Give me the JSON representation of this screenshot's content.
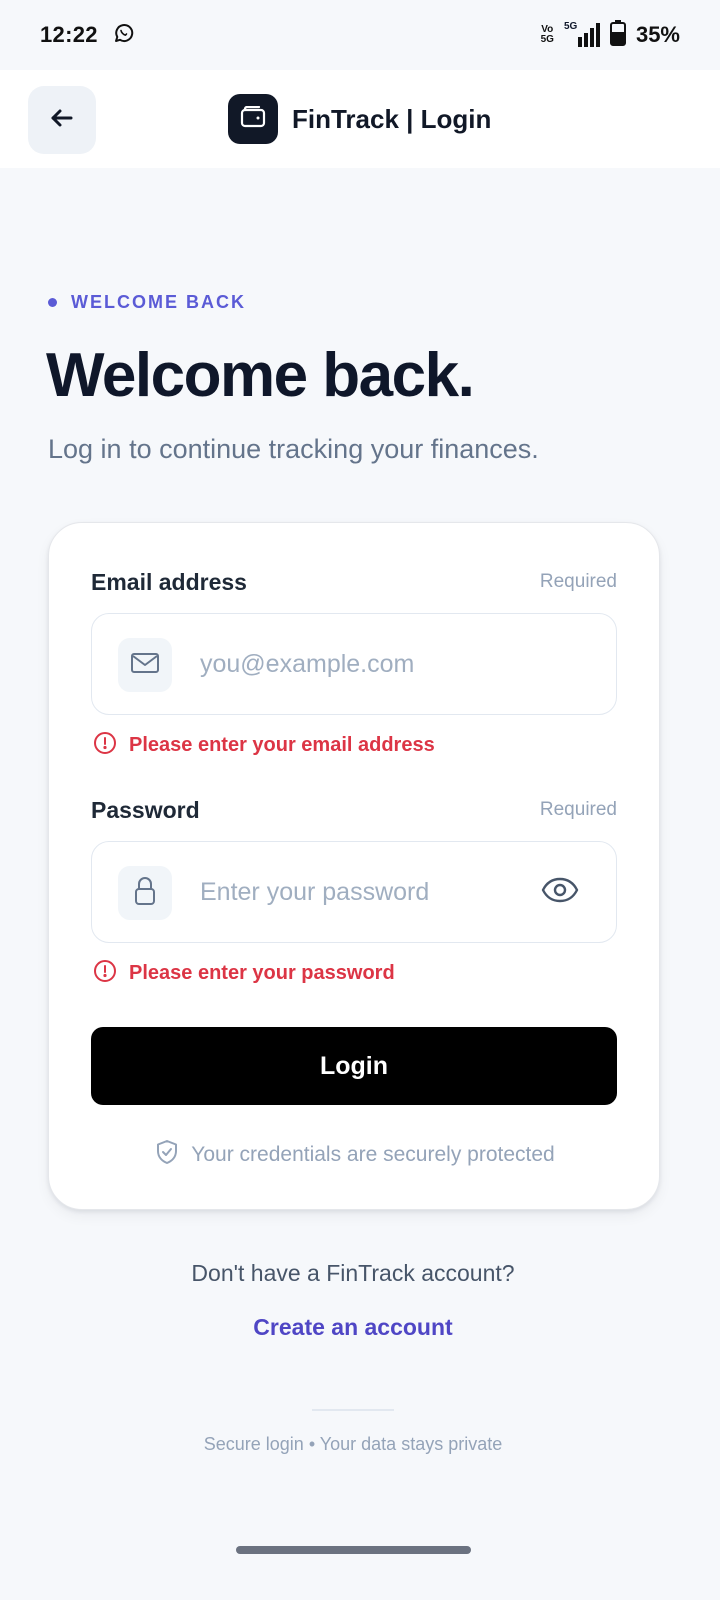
{
  "status_bar": {
    "time": "12:22",
    "network_top": "Vo",
    "network_bottom": "5G",
    "signal_label": "5G",
    "battery_percent": "35%"
  },
  "header": {
    "title": "FinTrack | Login",
    "back_icon": "arrow-left-icon",
    "logo_icon": "wallet-icon"
  },
  "intro": {
    "eyebrow": "WELCOME BACK",
    "title": "Welcome back.",
    "subtitle": "Log in to continue tracking your finances."
  },
  "form": {
    "email": {
      "label": "Email address",
      "required": "Required",
      "placeholder": "you@example.com",
      "value": "",
      "icon": "mail-icon",
      "error": "Please enter your email address"
    },
    "password": {
      "label": "Password",
      "required": "Required",
      "placeholder": "Enter your password",
      "value": "",
      "icon": "lock-icon",
      "toggle_icon": "eye-icon",
      "error": "Please enter your password"
    },
    "submit_label": "Login",
    "secure_note": "Your credentials are securely protected"
  },
  "footer": {
    "signup_prompt": "Don't have a FinTrack account?",
    "signup_link": "Create an account",
    "note": "Secure login • Your data stays private"
  },
  "colors": {
    "accent": "#5b5bd6",
    "link": "#4f46c5",
    "error": "#dc3545",
    "button": "#000000",
    "background": "#f6f8fb"
  }
}
